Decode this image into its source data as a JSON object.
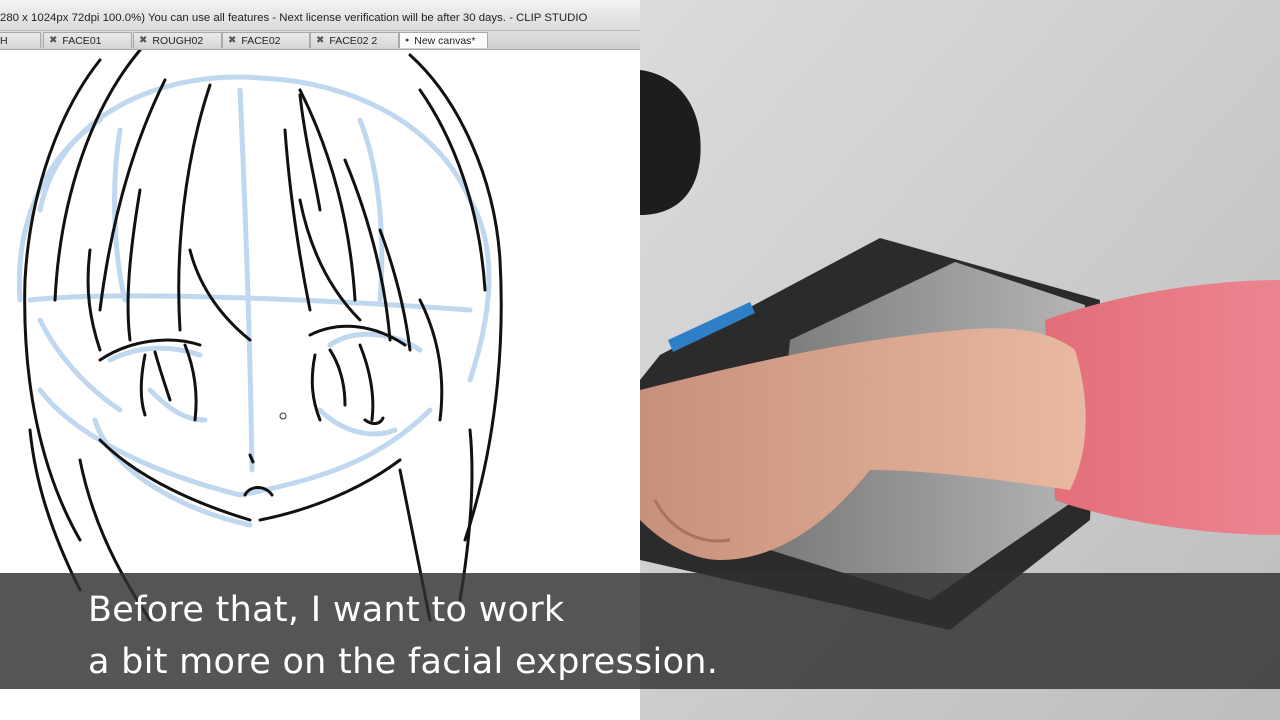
{
  "window": {
    "title": "280 x 1024px 72dpi 100.0%)  You can use all features - Next license verification will be after 30 days. - CLIP STUDIO"
  },
  "tabs": [
    {
      "label": "H",
      "close_icon": "close-icon",
      "state": "inactive"
    },
    {
      "label": "FACE01",
      "close_icon": "close-icon",
      "state": "inactive"
    },
    {
      "label": "ROUGH02",
      "close_icon": "close-icon",
      "state": "inactive"
    },
    {
      "label": "FACE02",
      "close_icon": "close-icon",
      "state": "inactive"
    },
    {
      "label": "FACE02 2",
      "close_icon": "close-icon",
      "state": "inactive"
    },
    {
      "label": "New canvas*",
      "close_icon": "modified-dot-icon",
      "state": "active"
    }
  ],
  "canvas": {
    "content": "drawing-canvas",
    "cursor_icon": "brush-cursor-icon",
    "rough_line_color": "#b9d3ee",
    "ink_line_color": "#111111"
  },
  "subtitle": {
    "line1": "Before that, I want to work",
    "line2": "a bit more on the facial expression."
  },
  "colors": {
    "subtitle_band": "#303030",
    "subtitle_text": "#ffffff",
    "sleeve": "#e8707c",
    "tablet": "#2b2b2c",
    "desk": "#d3d3d3"
  }
}
